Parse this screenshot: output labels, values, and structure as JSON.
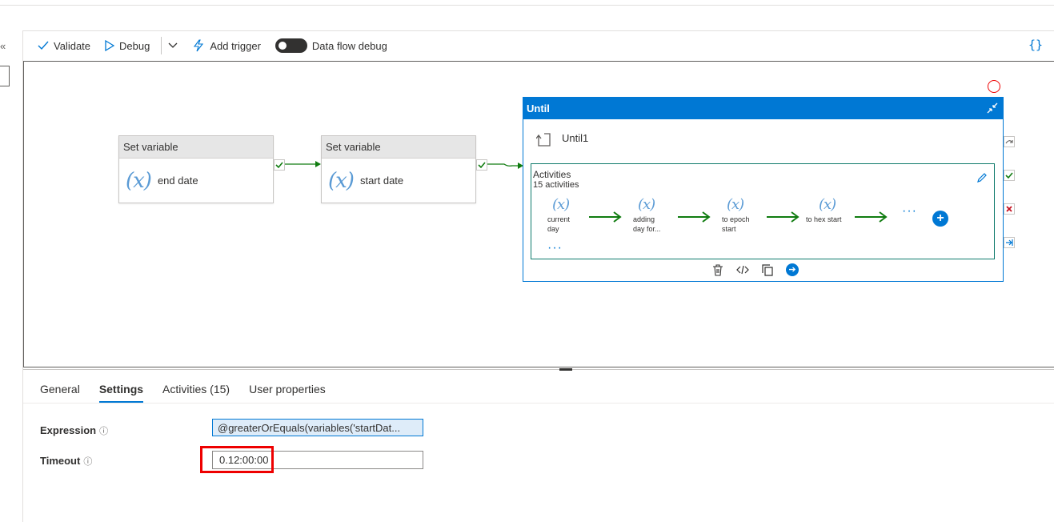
{
  "toolbar": {
    "validate": "Validate",
    "debug": "Debug",
    "add_trigger": "Add trigger",
    "data_flow_debug": "Data flow debug",
    "code_braces": "{}"
  },
  "left_rail": {
    "collapse": "«"
  },
  "canvas": {
    "activities": [
      {
        "header": "Set variable",
        "name": "end date"
      },
      {
        "header": "Set variable",
        "name": "start date"
      }
    ],
    "until": {
      "header": "Until",
      "name": "Until1",
      "activities_title": "Activities",
      "activities_count": "15 activities",
      "inner": [
        {
          "label_1": "current",
          "label_2": "day"
        },
        {
          "label_1": "adding",
          "label_2": "day for..."
        },
        {
          "label_1": "to epoch",
          "label_2": "start"
        },
        {
          "label_1": "to hex start",
          "label_2": ""
        }
      ],
      "ellipsis": "···"
    }
  },
  "tabs": [
    {
      "label": "General"
    },
    {
      "label": "Settings",
      "active": true
    },
    {
      "label": "Activities (15)"
    },
    {
      "label": "User properties"
    }
  ],
  "settings": {
    "expression_label": "Expression",
    "expression_value": "@greaterOrEquals(variables('startDat...",
    "timeout_label": "Timeout",
    "timeout_value": "0.12:00:00"
  },
  "colors": {
    "accent": "#0078d4",
    "success_arrow": "#107c10",
    "highlight": "#e00000"
  }
}
